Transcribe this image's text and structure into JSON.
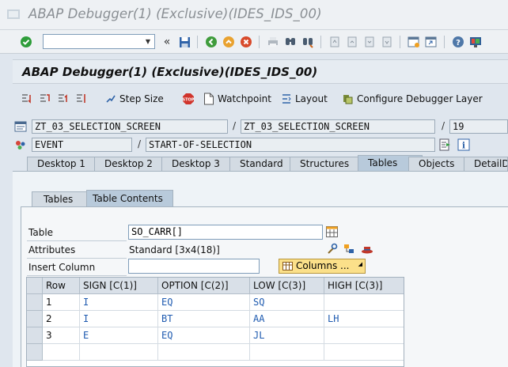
{
  "window": {
    "title": "ABAP Debugger(1)  (Exclusive)(IDES_IDS_00)"
  },
  "screen_title": "ABAP Debugger(1)  (Exclusive)(IDES_IDS_00)",
  "app_toolbar": {
    "step_size": "Step Size",
    "watchpoint": "Watchpoint",
    "layout": "Layout",
    "configure": "Configure Debugger Layer"
  },
  "info": {
    "program1": "ZT_03_SELECTION_SCREEN",
    "program2": "ZT_03_SELECTION_SCREEN",
    "line": "19",
    "event_type": "EVENT",
    "event_name": "START-OF-SELECTION",
    "slash": "/"
  },
  "tabs": [
    {
      "label": "Desktop 1"
    },
    {
      "label": "Desktop 2"
    },
    {
      "label": "Desktop 3"
    },
    {
      "label": "Standard"
    },
    {
      "label": "Structures"
    },
    {
      "label": "Tables"
    },
    {
      "label": "Objects"
    },
    {
      "label": "DetailDis"
    }
  ],
  "subtabs": [
    {
      "label": "Tables"
    },
    {
      "label": "Table Contents"
    }
  ],
  "form": {
    "table_label": "Table",
    "table_value": "SO_CARR[]",
    "attributes_label": "Attributes",
    "attributes_value": "Standard [3x4(18)]",
    "insert_column_label": "Insert Column",
    "insert_column_value": "",
    "columns_button": "Columns ..."
  },
  "grid": {
    "headers": [
      "Row",
      "SIGN [C(1)]",
      "OPTION [C(2)]",
      "LOW [C(3)]",
      "HIGH [C(3)]"
    ],
    "rows": [
      [
        "1",
        "I",
        "EQ",
        "SQ",
        ""
      ],
      [
        "2",
        "I",
        "BT",
        "AA",
        "LH"
      ],
      [
        "3",
        "E",
        "EQ",
        "JL",
        ""
      ]
    ]
  },
  "colors": {
    "accent": "#b8cadb",
    "value_text": "#1f5bb0",
    "columns_button": "#fbe08a"
  }
}
